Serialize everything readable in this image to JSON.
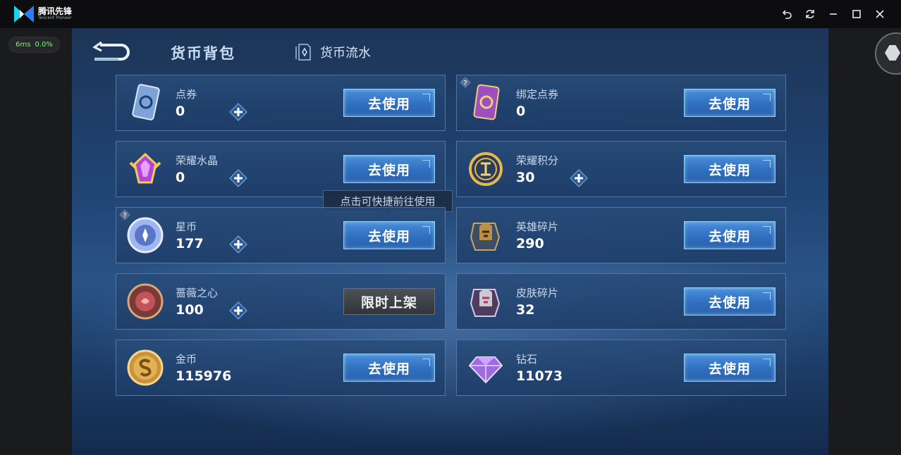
{
  "titlebar": {
    "app_name": "腾讯先锋",
    "app_subtitle": "Tencent Pioneer",
    "buttons": [
      "undo-icon",
      "refresh-icon",
      "minimize-icon",
      "maximize-icon",
      "close-icon"
    ]
  },
  "perf": {
    "ping": "6ms",
    "loss": "0.0%"
  },
  "header": {
    "active_tab": "货币背包",
    "flow_tab": "货币流水"
  },
  "tooltip": "点击可快捷前往使用",
  "cards": [
    {
      "name": "点券",
      "value": "0",
      "plus": true,
      "button": "去使用",
      "icon": "ticket-card-icon"
    },
    {
      "name": "绑定点券",
      "value": "0",
      "plus": false,
      "help": true,
      "button": "去使用",
      "icon": "bound-ticket-card-icon"
    },
    {
      "name": "荣耀水晶",
      "value": "0",
      "plus": true,
      "button": "去使用",
      "icon": "glory-crystal-icon"
    },
    {
      "name": "荣耀积分",
      "value": "30",
      "plus": true,
      "button": "去使用",
      "icon": "glory-points-icon"
    },
    {
      "name": "星币",
      "value": "177",
      "plus": true,
      "help": true,
      "button": "去使用",
      "icon": "star-coin-icon"
    },
    {
      "name": "英雄碎片",
      "value": "290",
      "plus": false,
      "button": "去使用",
      "icon": "hero-fragment-icon"
    },
    {
      "name": "蔷薇之心",
      "value": "100",
      "plus": true,
      "button": "限时上架",
      "icon": "rose-heart-icon"
    },
    {
      "name": "皮肤碎片",
      "value": "32",
      "plus": false,
      "button": "去使用",
      "icon": "skin-fragment-icon"
    },
    {
      "name": "金币",
      "value": "115976",
      "plus": false,
      "button": "去使用",
      "icon": "gold-coin-icon"
    },
    {
      "name": "钻石",
      "value": "11073",
      "plus": false,
      "button": "去使用",
      "icon": "diamond-icon"
    }
  ]
}
